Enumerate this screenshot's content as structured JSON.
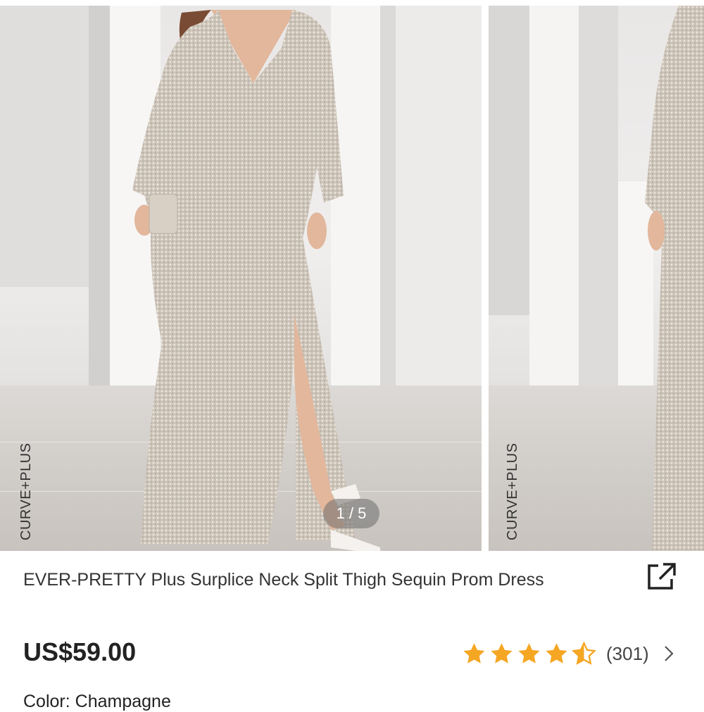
{
  "gallery": {
    "brand_tag": "CURVE+PLUS",
    "brand_tag_next": "CURVE+PLUS",
    "pager": "1 / 5"
  },
  "product": {
    "title": "EVER-PRETTY Plus Surplice Neck Split Thigh Sequin Prom Dress",
    "price": "US$59.00",
    "rating_value": 4.5,
    "rating_count": "(301)",
    "color_label": "Color:",
    "color_value": "Champagne"
  },
  "colors": {
    "star": "#f5a623",
    "dress": "#cfc6bb",
    "skin": "#e2b79c",
    "hair": "#7a4b34"
  },
  "icons": {
    "share": "share-external-icon",
    "chevron": "chevron-right-icon",
    "star": "star-icon"
  }
}
